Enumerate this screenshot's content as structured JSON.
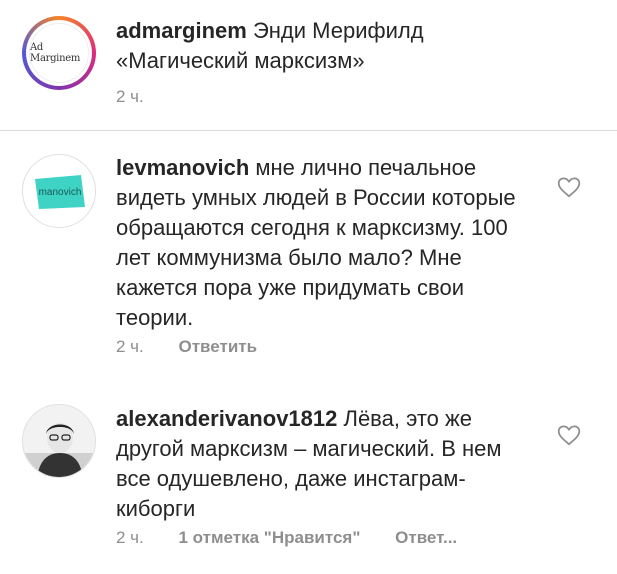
{
  "post": {
    "username": "admarginem",
    "text": "Энди Мерифилд «Магический марксизм»",
    "time": "2 ч.",
    "avatar_text": "Ad Marginem"
  },
  "comments": [
    {
      "username": "levmanovich",
      "text": "мне лично печальное видеть умных людей в России которые обращаются сегодня к марксизму. 100 лет коммунизма было мало? Мне кажется пора уже придумать свои теории.",
      "time": "2 ч.",
      "reply_label": "Ответить",
      "avatar_text": "manovich"
    },
    {
      "username": "alexanderivanov1812",
      "text": "Лёва, это же другой марксизм – магический. В нем все одушевлено, даже инстаграм-киборги",
      "time": "2 ч.",
      "likes_label": "1 отметка \"Нравится\"",
      "reply_label": "Ответ..."
    }
  ],
  "colors": {
    "accent_teal": "#3ed3c4",
    "meta_gray": "#8e8e8e",
    "text": "#262626"
  },
  "icons": {
    "like": "heart-outline-icon"
  }
}
